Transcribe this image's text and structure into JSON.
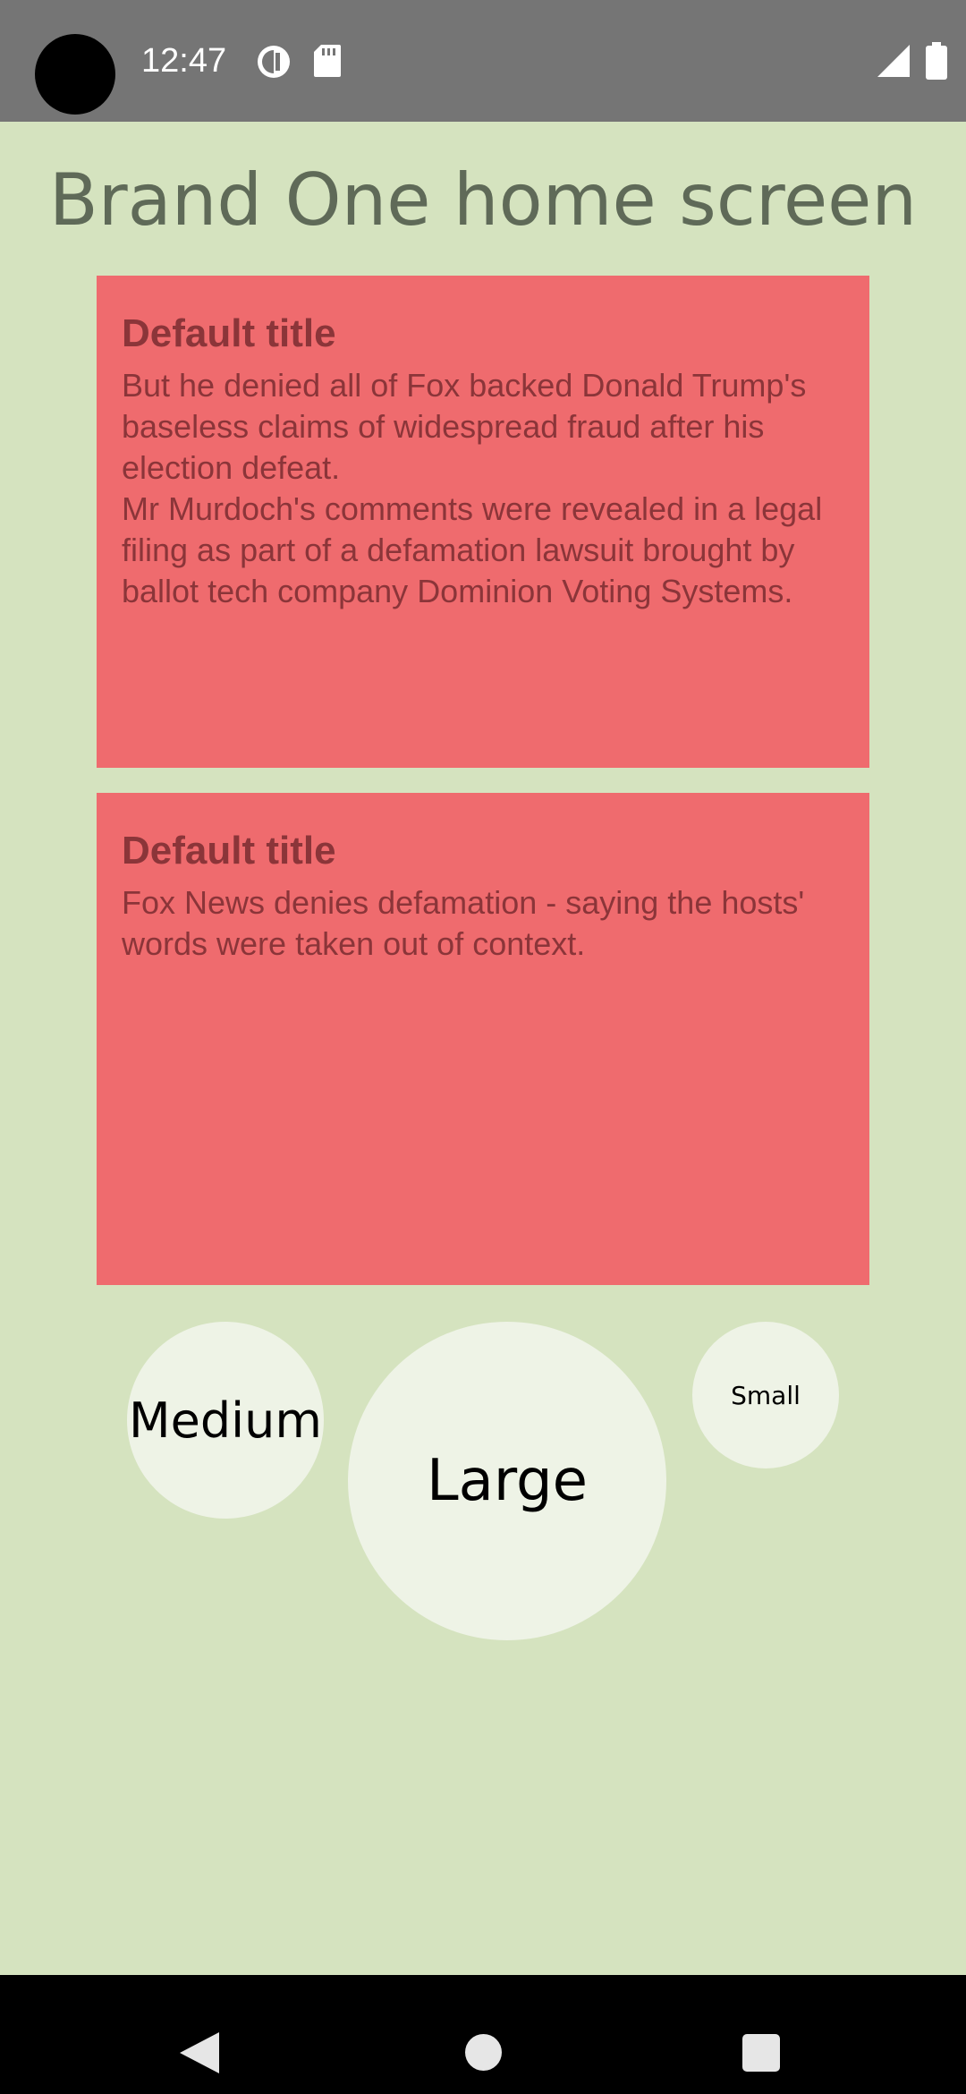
{
  "status_bar": {
    "time": "12:47",
    "icons": [
      "camera-cutout",
      "privacy-indicator-icon",
      "sd-card-icon",
      "cellular-signal-icon",
      "battery-icon"
    ],
    "background_color": "#757575"
  },
  "page": {
    "title": "Brand One home screen",
    "background_color": "#d5e3bf"
  },
  "cards": [
    {
      "title": "Default title",
      "body": "But he denied all of Fox backed Donald Trump's baseless claims of widespread fraud after his election defeat.\nMr Murdoch's comments were revealed in a legal filing as part of a defamation lawsuit brought by ballot tech company Dominion Voting Systems."
    },
    {
      "title": "Default title",
      "body": "Fox News denies defamation - saying the hosts' words were taken out of context."
    }
  ],
  "card_style": {
    "background_color": "#ef6b6e",
    "text_color": "#8b3539"
  },
  "size_buttons": {
    "medium": "Medium",
    "large": "Large",
    "small": "Small",
    "background_color": "#eef3e6"
  },
  "nav_bar": {
    "icons": [
      "back-icon",
      "home-icon",
      "recents-icon"
    ]
  }
}
